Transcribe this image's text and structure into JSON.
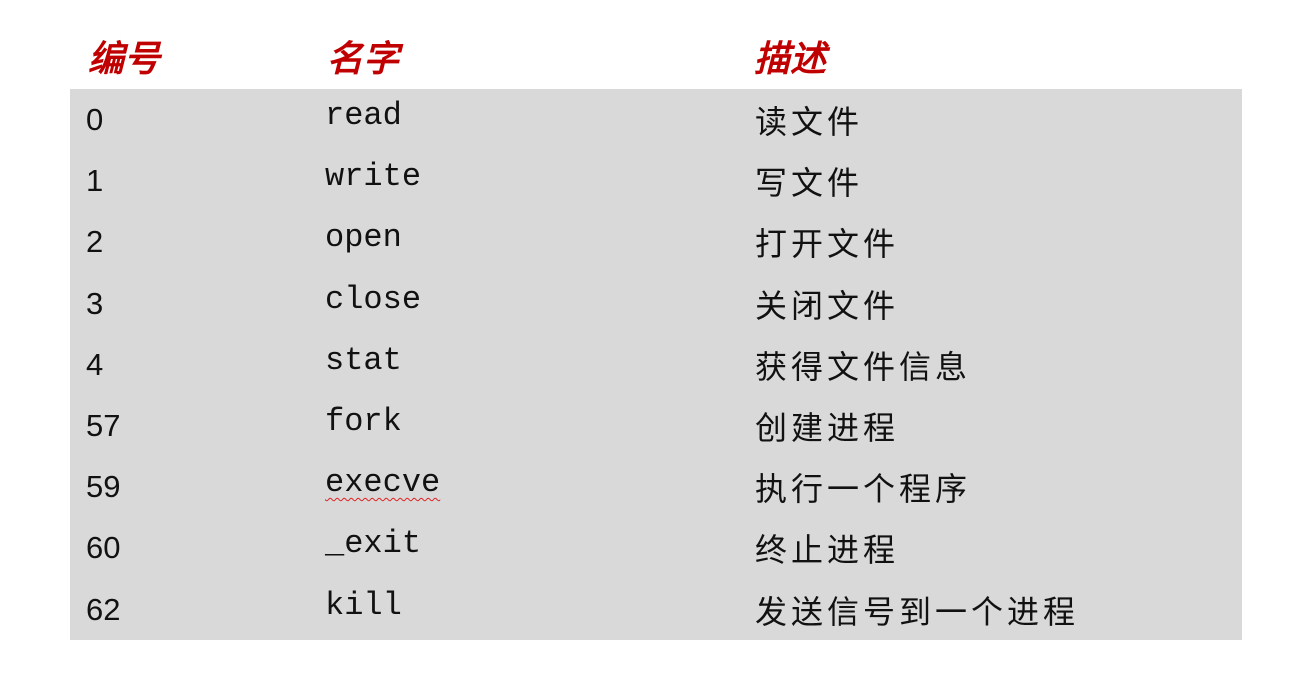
{
  "table": {
    "headers": {
      "number": "编号",
      "name": "名字",
      "description": "描述"
    },
    "rows": [
      {
        "number": "0",
        "name": "read",
        "description": "读文件"
      },
      {
        "number": "1",
        "name": "write",
        "description": "写文件"
      },
      {
        "number": "2",
        "name": "open",
        "description": "打开文件"
      },
      {
        "number": "3",
        "name": "close",
        "description": "关闭文件"
      },
      {
        "number": "4",
        "name": "stat",
        "description": "获得文件信息"
      },
      {
        "number": "57",
        "name": "fork",
        "description": "创建进程"
      },
      {
        "number": "59",
        "name": "execve",
        "description": "执行一个程序"
      },
      {
        "number": "60",
        "name": "_exit",
        "description": "终止进程"
      },
      {
        "number": "62",
        "name": "kill",
        "description": "发送信号到一个进程"
      }
    ]
  },
  "colors": {
    "header_text": "#c00000",
    "body_background": "#d9d9d9",
    "spellcheck_underline": "#e02020"
  }
}
